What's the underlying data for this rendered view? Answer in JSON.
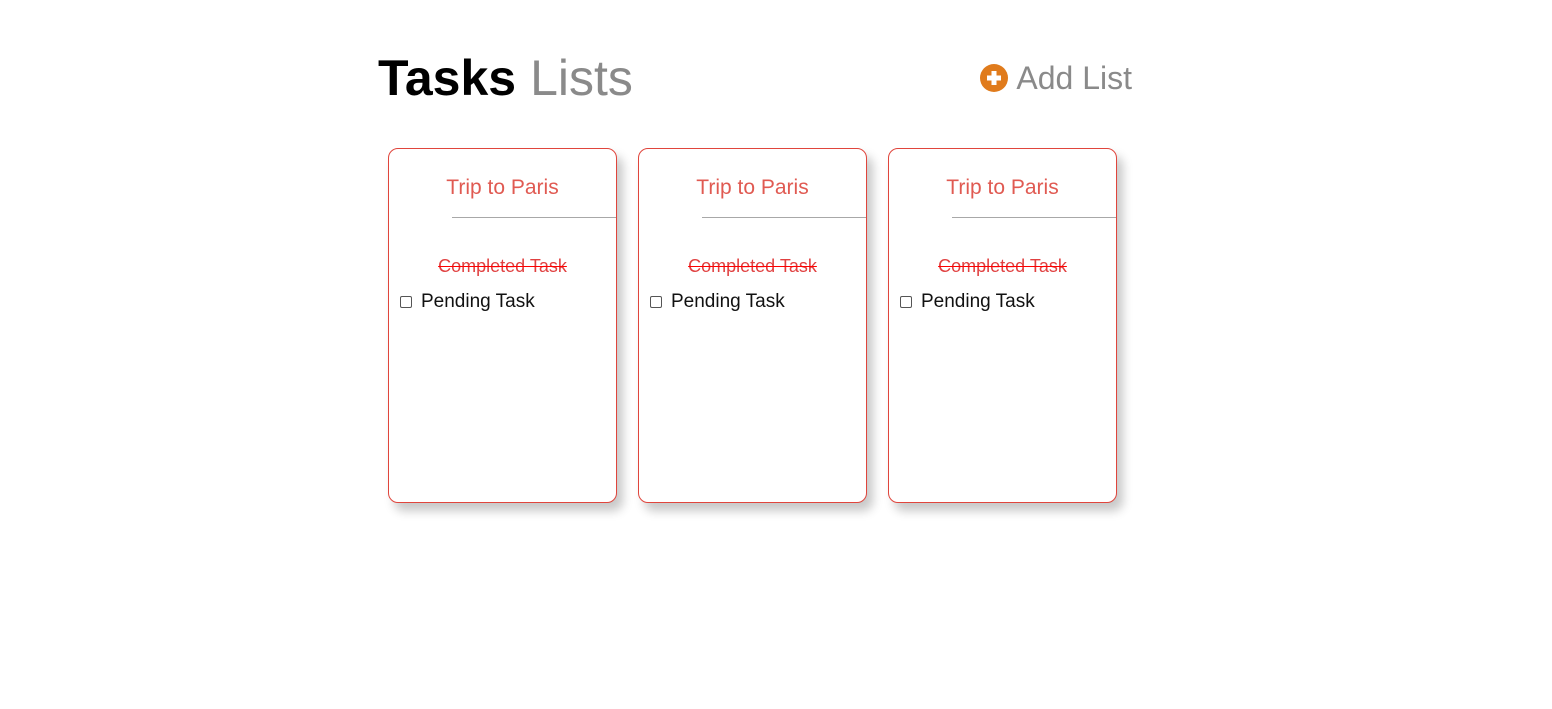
{
  "header": {
    "title_strong": "Tasks",
    "title_light": "Lists",
    "add_list_label": "Add List",
    "add_icon": "plus-circle-icon",
    "accent_color": "#e07b1c"
  },
  "lists": [
    {
      "title": "Trip to Paris",
      "completed_task": "Completed Task",
      "pending_task": "Pending Task"
    },
    {
      "title": "Trip to Paris",
      "completed_task": "Completed Task",
      "pending_task": "Pending Task"
    },
    {
      "title": "Trip to Paris",
      "completed_task": "Completed Task",
      "pending_task": "Pending Task"
    }
  ],
  "colors": {
    "card_border": "#e0453c",
    "card_title": "#e05a52",
    "completed_task": "#e04040"
  }
}
